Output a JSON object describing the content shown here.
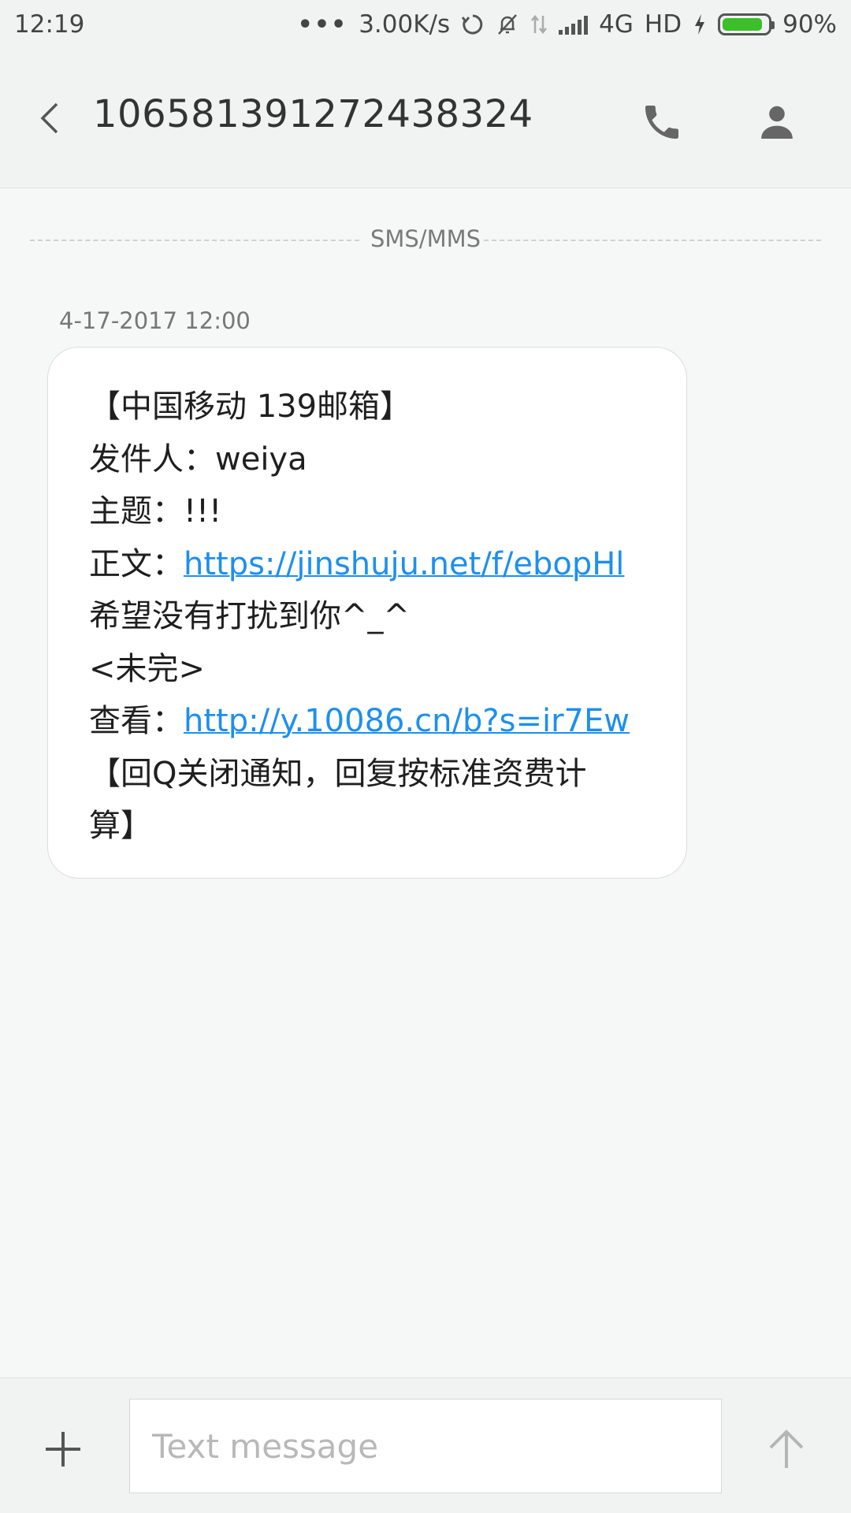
{
  "status_bar": {
    "time": "12:19",
    "dots": "•••",
    "net_speed": "3.00K/s",
    "network": "4G",
    "hd": "HD",
    "battery": "90%",
    "battery_level": 0.9,
    "icons": [
      "sync-icon",
      "mute-notifications-icon",
      "data-transfer-icon",
      "signal-icon",
      "charging-icon",
      "battery-icon"
    ]
  },
  "header": {
    "title": "10658139127243832 4",
    "actions": [
      "back-icon",
      "phone-icon",
      "contact-icon"
    ]
  },
  "thread": {
    "divider_label": "SMS/MMS",
    "timestamp": "4-17-2017 12:00",
    "message": {
      "line1": "【中国移动 139邮箱】",
      "line2": "发件人：weiya",
      "line3": "主题：!!!",
      "line4_prefix": "正文：",
      "line4_link": "https://jinshuju.net/f/ebopHl",
      "line5": "希望没有打扰到你^_^",
      "line6": "<未完>",
      "line7_prefix": "查看：",
      "line7_link": "http://y.10086.cn/b?s=ir7Ew",
      "line8": "【回Q关闭通知，回复按标准资费计",
      "line9": "算】"
    }
  },
  "composer": {
    "placeholder": "Text message",
    "icons": [
      "add-icon",
      "send-icon"
    ]
  },
  "colors": {
    "link": "#1d8ff0",
    "battery_fill": "#3cbf2a",
    "background": "#f6f7f7"
  }
}
